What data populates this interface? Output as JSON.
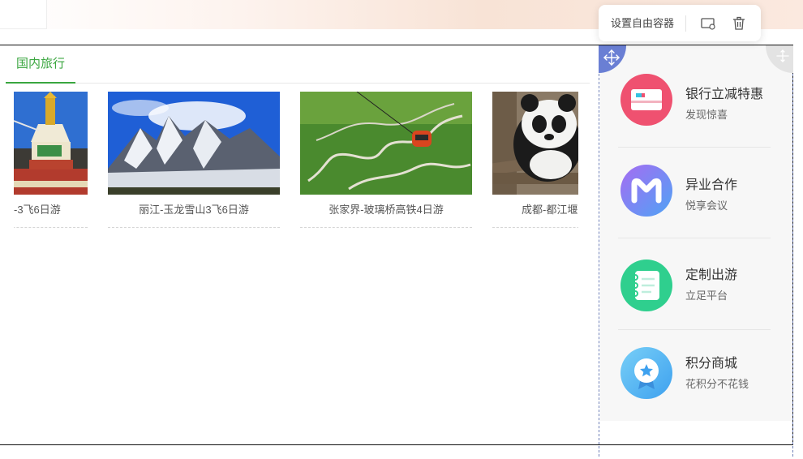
{
  "toolbar": {
    "set_free_container_label": "设置自由容器",
    "settings_icon": "container-settings-icon",
    "delete_icon": "trash-icon"
  },
  "tabs": [
    {
      "label": "国内旅行",
      "active": true
    }
  ],
  "cards": [
    {
      "caption": "-3飞6日游",
      "image": "tibet-stupa"
    },
    {
      "caption": "丽江-玉龙雪山3飞6日游",
      "image": "snow-mountain"
    },
    {
      "caption": "张家界-玻璃桥高铁4日游",
      "image": "cable-car-valley"
    },
    {
      "caption": "成都-都江堰",
      "image": "panda"
    }
  ],
  "services": [
    {
      "title": "银行立减特惠",
      "subtitle": "发现惊喜",
      "icon": "bank-card-icon",
      "color": "#ef5170"
    },
    {
      "title": "异业合作",
      "subtitle": "悦享会议",
      "icon": "m-logo-icon",
      "color": "#6d8cf2"
    },
    {
      "title": "定制出游",
      "subtitle": "立足平台",
      "icon": "notebook-icon",
      "color": "#2fcf8e"
    },
    {
      "title": "积分商城",
      "subtitle": "花积分不花钱",
      "icon": "badge-icon",
      "color": "#4db3f3"
    }
  ],
  "colors": {
    "accent_green": "#3aa63f",
    "handle_blue": "#6a7fd4"
  }
}
